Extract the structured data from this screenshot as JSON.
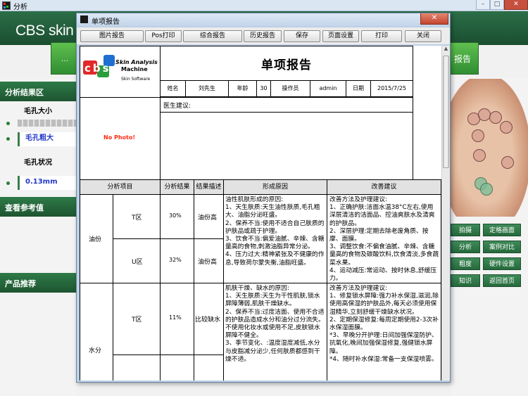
{
  "outer_window": {
    "title": "分析",
    "brand": "CBS skin",
    "right_button": "报告"
  },
  "left_panel": {
    "section1": "分析结果区",
    "pore_size_label": "毛孔大小",
    "pore_size_value": "毛孔粗大",
    "pore_status_label": "毛孔状况",
    "pore_status_value": "0.13mm",
    "section2": "查看参考值",
    "section3": "产品推荐"
  },
  "right_panel": {
    "buttons": [
      "拍摄",
      "定格画面",
      "分析",
      "案例对比",
      "报告",
      "硬件设置",
      "知识",
      "返回首页"
    ],
    "button_left_visible": [
      "拍摄",
      "分析",
      "粗度",
      "知识"
    ]
  },
  "dialog": {
    "title": "单项报告",
    "close_label": "x",
    "toolbar": [
      "图片报告",
      "Pos打印",
      "综合报告",
      "历史报告",
      "保存",
      "页面设置",
      "打印",
      "关闭"
    ]
  },
  "report": {
    "title": "单项报告",
    "logo_text": "Skin Analysis",
    "logo_subtext": "Machine",
    "logo_software": "Skin Software",
    "logo_letters": "cbs",
    "info_labels": {
      "name": "姓名",
      "age": "年龄",
      "operator": "操作员",
      "date": "日期"
    },
    "info_values": {
      "name": "刘先生",
      "age": "30",
      "operator": "admin",
      "date": "2015/7/25"
    },
    "doctor_advice_label": "医生建议:",
    "no_photo": "No Photo!",
    "table_headers": [
      "分析项目",
      "分析结果",
      "结果描述",
      "形成原因",
      "改善建议"
    ],
    "rows": [
      {
        "item": "油份",
        "sub": [
          {
            "zone": "T区",
            "result": "30%",
            "desc": "油份高"
          },
          {
            "zone": "U区",
            "result": "32%",
            "desc": "油份高"
          }
        ],
        "cause": "油性肌肤形成的原因:\n1、天生肤质:天生油性肤质,毛孔粗大、油脂分泌旺盛。\n2、保养不当:使用不适合自己肤质的护肤品或疏于护理。\n3、饮食不当:偏爱油腻、辛辣、含糖量高的食物,刺激油脂异常分泌。\n4、压力过大:精神紧张及不健康的作息,导致荷尔蒙失衡,油脂旺盛。",
        "advice": "改善方法及护理建议:\n1、正确护肤:洁面水温38°C左右,使用深层清洁的洁面品、控油爽肤水及清爽的护肤品。\n2、深层护理:定期去除老废角质、按摩、面膜。\n3、调整饮食:不偏食油腻、辛辣、含糖量高的食物及碳酸饮料,饮食清淡,多食蔬菜水果。\n4、运动减压:常运动、按时休息,舒缓压力。"
      },
      {
        "item": "水分",
        "sub": [
          {
            "zone": "T区",
            "result": "11%",
            "desc": "比较缺水"
          }
        ],
        "cause": "肌肤干燥、缺水的原因:\n1、天生肤质:天生为干性肌肤,锁水屏障薄弱,肌肤干燥缺水。\n2、保养不当:过度洁面、使用不合适的护肤品造成水分和油分过分流失。\n不使用化妆水或使用不足,皮肤锁水屏障不健全。\n3、季节变化、:温度湿度减低,水分与皮脂减分泌少,任何肤质都感到干燥不适。",
        "advice": "改善方法及护理建议:\n1、修复锁水屏障:强力补水保湿,滋润,除使用高保湿的护肤品外,每天必须使用保湿精华,立刻舒缓干燥缺水状况。\n2、定期保湿修复:每周定期使用2-3次补水保湿面膜。\n*3、早晚分开护理:日间加强保湿防护、抗氧化,晚间加强保湿修复,强健锁水屏障。\n*4、随时补水保湿:常备一支保湿喷雾。"
      }
    ]
  }
}
